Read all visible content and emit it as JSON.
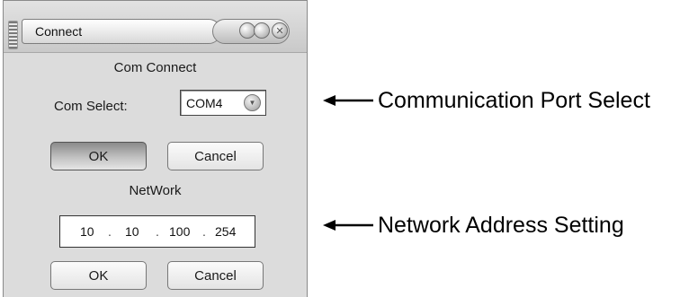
{
  "window": {
    "title": "Connect",
    "controls": {
      "minimize_icon": "minimize-icon",
      "maximize_icon": "maximize-icon",
      "close_icon": "close-icon",
      "close_glyph": "✕"
    }
  },
  "com": {
    "section_title": "Com Connect",
    "select_label": "Com Select:",
    "select_value": "COM4",
    "dropdown_icon": "dropdown-icon",
    "ok_label": "OK",
    "cancel_label": "Cancel"
  },
  "network": {
    "section_title": "NetWork",
    "ip_octets": [
      "10",
      "10",
      "100",
      "254"
    ],
    "separator": ".",
    "ok_label": "OK",
    "cancel_label": "Cancel"
  },
  "annotations": [
    {
      "text": "Communication Port Select",
      "icon": "left-arrow-icon"
    },
    {
      "text": "Network Address Setting",
      "icon": "left-arrow-icon"
    }
  ],
  "colors": {
    "window_bg": "#dcdcdc",
    "pressed_button": "#9a9a9a",
    "annotation_text": "#000000"
  }
}
